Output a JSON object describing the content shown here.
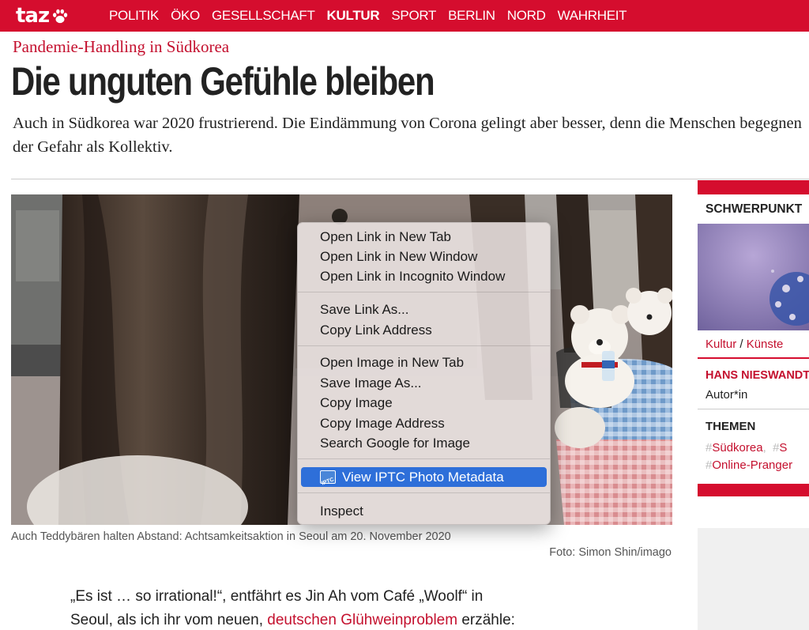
{
  "nav": {
    "logo": "taz",
    "items": [
      {
        "label": "POLITIK",
        "active": false
      },
      {
        "label": "ÖKO",
        "active": false
      },
      {
        "label": "GESELLSCHAFT",
        "active": false
      },
      {
        "label": "KULTUR",
        "active": true
      },
      {
        "label": "SPORT",
        "active": false
      },
      {
        "label": "BERLIN",
        "active": false
      },
      {
        "label": "NORD",
        "active": false
      },
      {
        "label": "WAHRHEIT",
        "active": false
      }
    ]
  },
  "article": {
    "kicker": "Pandemie-Handling in Südkorea",
    "headline": "Die unguten Gefühle bleiben",
    "lead": "Auch in Südkorea war 2020 frustrierend. Die Eindämmung von Corona gelingt aber besser, denn die Menschen begegnen der Gefahr als Kollektiv.",
    "caption": "Auch Teddybären halten Abstand: Achtsamkeitsaktion in Seoul am 20. November 2020",
    "credit": "Foto: Simon Shin/imago",
    "body_line1": "„Es ist … so irrational!“, entfährt es Jin Ah vom Café „Woolf“ in",
    "body_line2_prefix": "Seoul, als ich ihr vom neuen, ",
    "body_line2_link": "deutschen Glühweinproblem",
    "body_line2_suffix": " erzähle:"
  },
  "sidebar": {
    "title": "SCHWERPUNKT",
    "category_1": "Kultur",
    "category_sep": " / ",
    "category_2": "Künste",
    "author": "HANS NIESWANDT",
    "author_role": "Autor*in",
    "themen_label": "THEMEN",
    "tags": [
      "Südkorea",
      "S",
      "Online-Pranger"
    ]
  },
  "context_menu": {
    "items": [
      "Open Link in New Tab",
      "Open Link in New Window",
      "Open Link in Incognito Window",
      "Save Link As...",
      "Copy Link Address",
      "Open Image in New Tab",
      "Save Image As...",
      "Copy Image",
      "Copy Image Address",
      "Search Google for Image",
      "View IPTC Photo Metadata",
      "Inspect"
    ],
    "highlighted": "View IPTC Photo Metadata",
    "iptc_icon_label": "IPTC"
  },
  "colors": {
    "brand_red": "#d50d2e",
    "link_red": "#c4102e",
    "highlight_blue": "#2e6fd9"
  }
}
